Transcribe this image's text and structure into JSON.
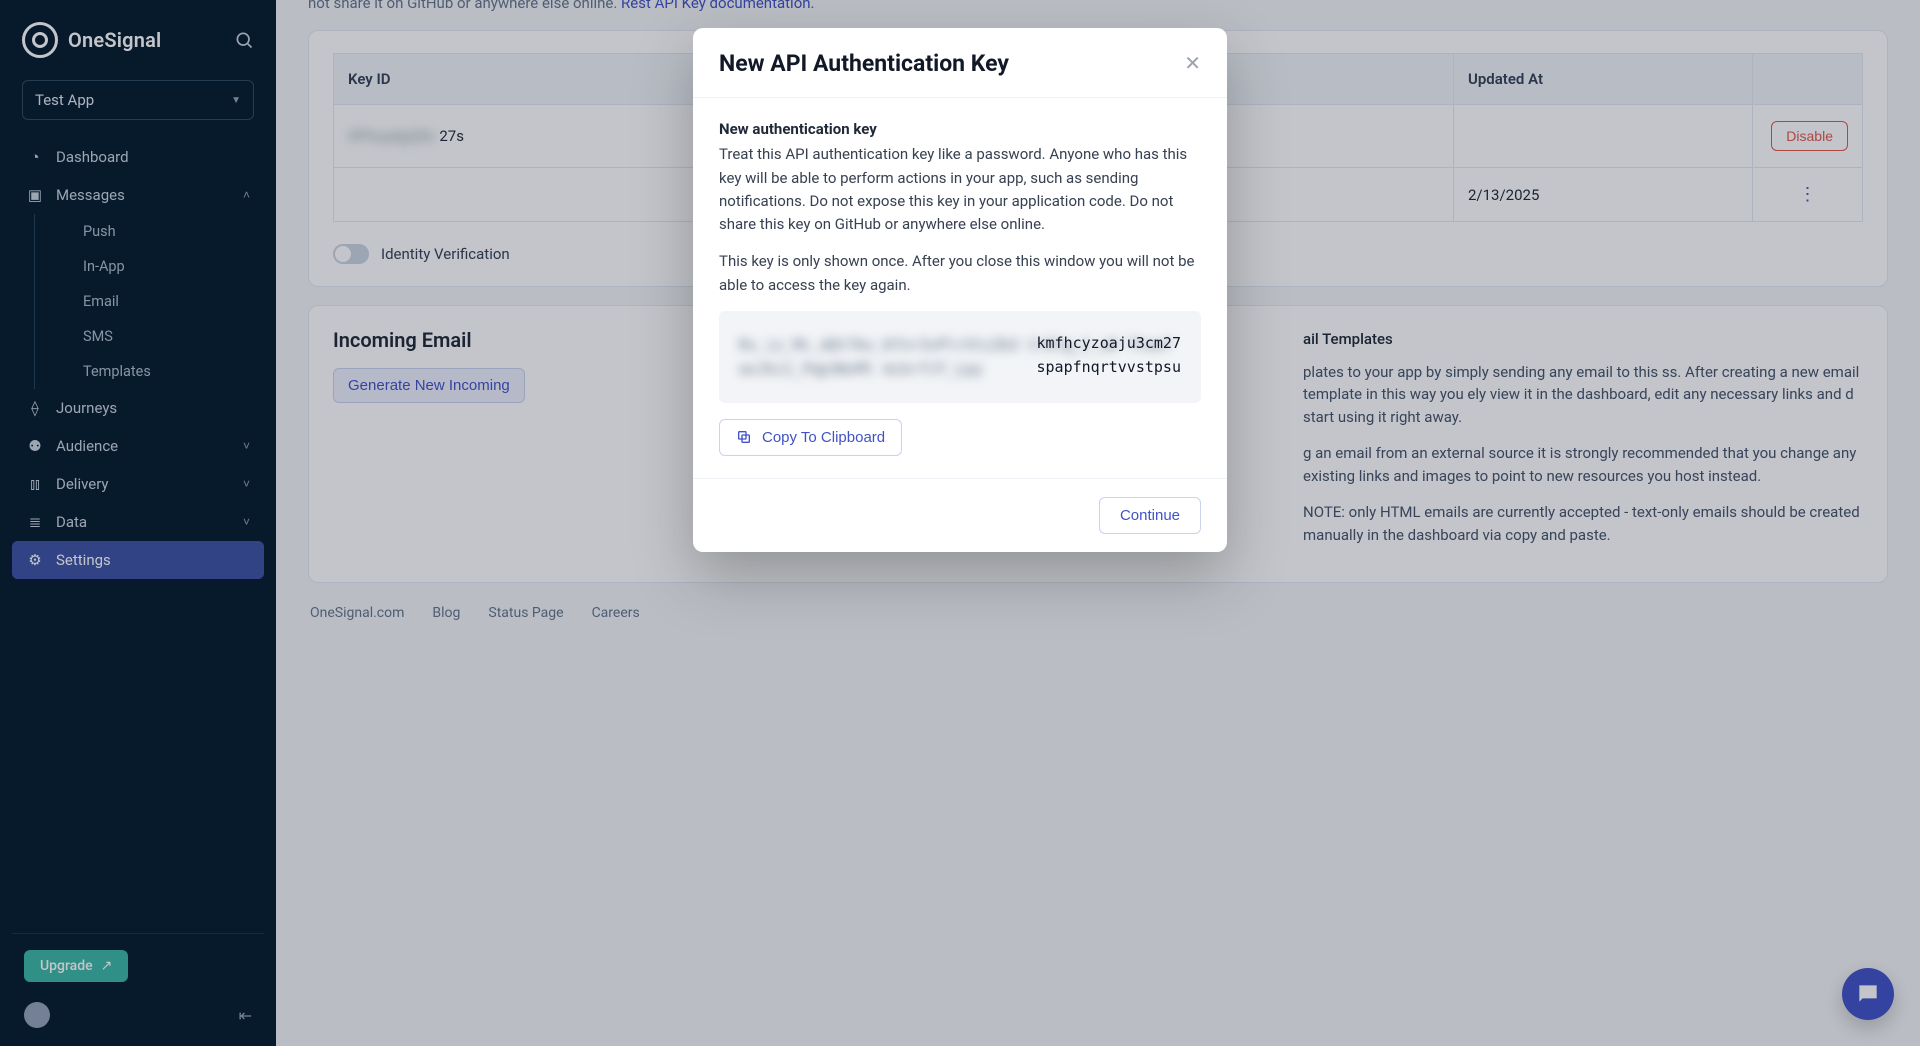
{
  "brand": {
    "name": "OneSignal"
  },
  "app_selector": {
    "label": "Test App"
  },
  "nav": {
    "dashboard": "Dashboard",
    "messages": "Messages",
    "messages_sub": {
      "push": "Push",
      "inapp": "In-App",
      "email": "Email",
      "sms": "SMS",
      "templates": "Templates"
    },
    "journeys": "Journeys",
    "audience": "Audience",
    "delivery": "Delivery",
    "data": "Data",
    "settings": "Settings",
    "upgrade": "Upgrade"
  },
  "top_strip": {
    "text_prefix": "not share it on GitHub or anywhere else online. ",
    "link": "Rest API Key documentation."
  },
  "keys_table": {
    "headers": {
      "key_id": "Key ID",
      "updated_at": "Updated At"
    },
    "row1": {
      "blur": "XPhuydg2j9c",
      "prefix": "27s",
      "disable": "Disable"
    },
    "row2": {
      "updated_at": "2/13/2025"
    }
  },
  "identity_toggle": {
    "label": "Identity Verification"
  },
  "incoming": {
    "title": "Incoming Email",
    "generate_btn": "Generate New Incoming",
    "right_heading": "ail Templates",
    "p1": "plates to your app by simply sending any email to this ss. After creating a new email template in this way you ely view it in the dashboard, edit any necessary links and d start using it right away.",
    "p2": "g an email from an external source it is strongly recommended that you change any existing links and images to point to new resources you host instead.",
    "p3": "NOTE: only HTML emails are currently accepted - text-only emails should be created manually in the dashboard via copy and paste."
  },
  "footer": {
    "l1": "OneSignal.com",
    "l2": "Blog",
    "l3": "Status Page",
    "l4": "Careers"
  },
  "modal": {
    "title": "New API Authentication Key",
    "lead": "New authentication key",
    "p1": "Treat this API authentication key like a password. Anyone who has this key will be able to perform actions in your app, such as sending notifications. Do not expose this key in your application code. Do not share this key on GitHub or anywhere else online.",
    "p2": "This key is only shown once. After you close this window you will not be able to access the key again.",
    "key_hidden": "Rv_iz_Mc_dQt7bv_Kfnr3vPlrVtzZb3 Cr6lg_C_uO Ttue7axJki1_Pqp3WzMl mikrfJf_Lpy",
    "key_visible_1": "kmfhcyzoaju3cm27",
    "key_visible_2": "spapfnqrtvvstpsu",
    "copy_btn": "Copy To Clipboard",
    "continue_btn": "Continue"
  }
}
